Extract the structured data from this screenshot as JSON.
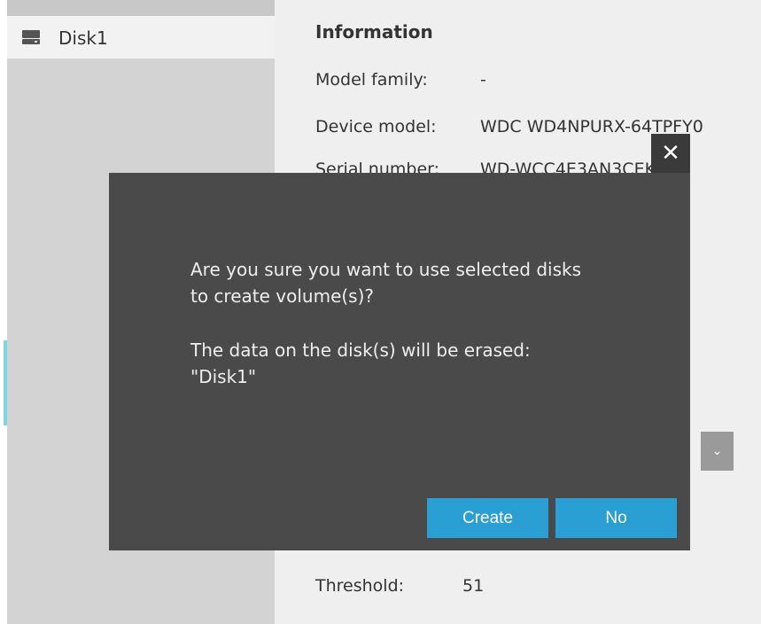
{
  "sidebar": {
    "items": [
      {
        "label": "Disk1",
        "icon": "hard-disk-icon"
      }
    ]
  },
  "info": {
    "title": "Information",
    "model_family_label": "Model family:",
    "model_family_value": "-",
    "device_model_label": "Device model:",
    "device_model_value": "WDC WD4NPURX-64TPFY0",
    "serial_label": "Serial number:",
    "serial_value": "WD-WCC4E3AN3CEK",
    "threshold_label": "Threshold:",
    "threshold_value": "51"
  },
  "dialog": {
    "message_line1": "Are you sure you want to use selected disks",
    "message_line2": "to create volume(s)?",
    "message_line3": "The data on the disk(s) will be erased:",
    "message_line4": "\"Disk1\"",
    "create_label": "Create",
    "no_label": "No",
    "close_icon": "close-icon",
    "close_glyph": "✕"
  },
  "colors": {
    "accent": "#2a9fd3",
    "dialog_bg": "#4a4a4a",
    "sidebar_bg": "#d3d3d3",
    "panel_bg": "#efefef"
  }
}
